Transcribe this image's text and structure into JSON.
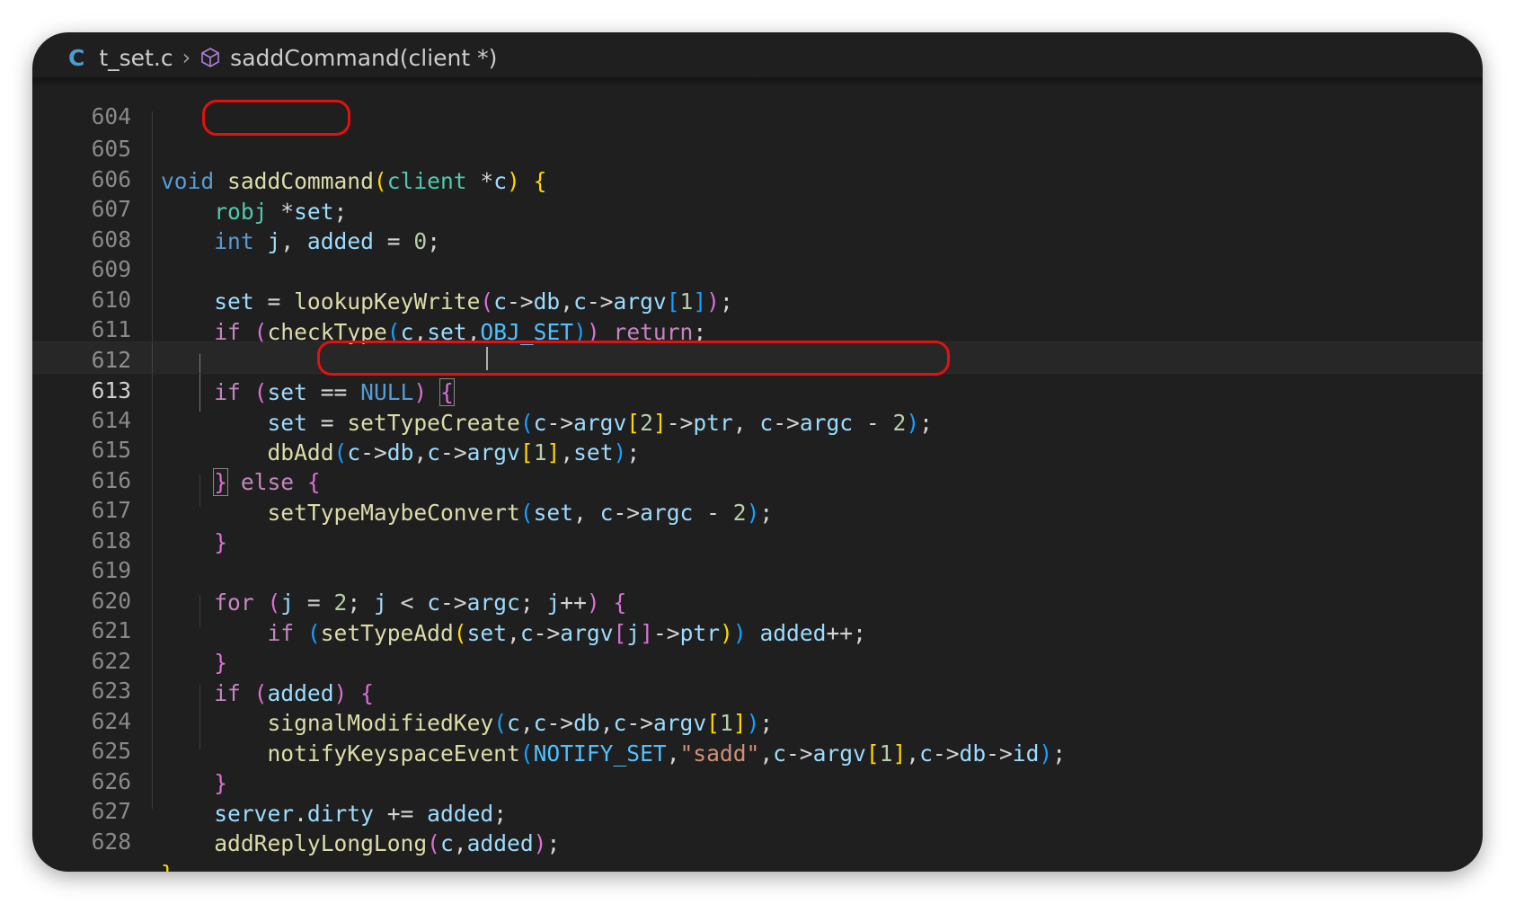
{
  "breadcrumb": {
    "lang_icon": "C",
    "file": "t_set.c",
    "separator_icon": "chevron-right-icon",
    "symbol_icon": "cube-icon",
    "symbol": "saddCommand(client *)"
  },
  "editor": {
    "partial_top_line": "604",
    "current_line": "613",
    "lines": [
      {
        "n": "605"
      },
      {
        "n": "606"
      },
      {
        "n": "607"
      },
      {
        "n": "608"
      },
      {
        "n": "609"
      },
      {
        "n": "610"
      },
      {
        "n": "611"
      },
      {
        "n": "612"
      },
      {
        "n": "613"
      },
      {
        "n": "614"
      },
      {
        "n": "615"
      },
      {
        "n": "616"
      },
      {
        "n": "617"
      },
      {
        "n": "618"
      },
      {
        "n": "619"
      },
      {
        "n": "620"
      },
      {
        "n": "621"
      },
      {
        "n": "622"
      },
      {
        "n": "623"
      },
      {
        "n": "624"
      },
      {
        "n": "625"
      },
      {
        "n": "626"
      },
      {
        "n": "627"
      },
      {
        "n": "628"
      }
    ]
  },
  "annotations": {
    "color": "#e2120f",
    "boxes": [
      "saddCommand",
      "setTypeCreate(c->argv[2]->ptr, c->argc - 2);"
    ]
  }
}
